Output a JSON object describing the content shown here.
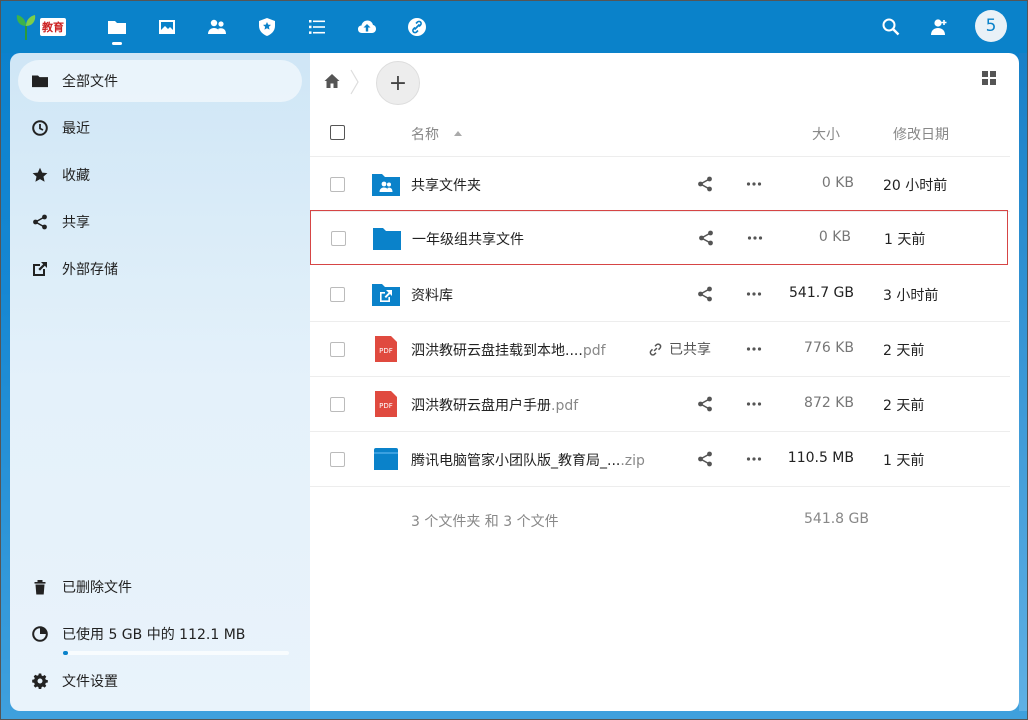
{
  "header": {
    "logo_text": "教育",
    "avatar_letter": "5",
    "apps": [
      {
        "icon": "folder-icon",
        "name": "files"
      },
      {
        "icon": "image-icon",
        "name": "photos"
      },
      {
        "icon": "contacts-icon",
        "name": "contacts"
      },
      {
        "icon": "shield-icon",
        "name": "security"
      },
      {
        "icon": "list-icon",
        "name": "activity"
      },
      {
        "icon": "cloud-upload-icon",
        "name": "upload"
      },
      {
        "icon": "link-icon",
        "name": "external"
      }
    ]
  },
  "sidebar": {
    "items": [
      {
        "label": "全部文件",
        "icon": "folder-icon"
      },
      {
        "label": "最近",
        "icon": "clock-icon"
      },
      {
        "label": "收藏",
        "icon": "star-icon"
      },
      {
        "label": "共享",
        "icon": "share-icon"
      },
      {
        "label": "外部存储",
        "icon": "external-link-icon"
      }
    ],
    "deleted_label": "已删除文件",
    "quota_label": "已使用 5 GB 中的 112.1 MB",
    "quota_fraction": 0.022,
    "settings_label": "文件设置"
  },
  "main": {
    "add_label": "+",
    "columns": {
      "name": "名称",
      "size": "大小",
      "date": "修改日期"
    },
    "files": [
      {
        "name": "共享文件夹",
        "ext": "",
        "type": "shared-folder",
        "size": "0 KB",
        "date": "20 小时前",
        "shared": false
      },
      {
        "name": "一年级组共享文件",
        "ext": "",
        "type": "folder",
        "size": "0 KB",
        "date": "1 天前",
        "shared": false,
        "selected": true
      },
      {
        "name": "资料库",
        "ext": "",
        "type": "external-folder",
        "size": "541.7 GB",
        "date": "3 小时前",
        "shared": false
      },
      {
        "name": "泗洪教研云盘挂载到本地....",
        "ext": "pdf",
        "type": "pdf",
        "size": "776 KB",
        "date": "2 天前",
        "shared": true,
        "shared_label": "已共享"
      },
      {
        "name": "泗洪教研云盘用户手册",
        "ext": ".pdf",
        "type": "pdf",
        "size": "872 KB",
        "date": "2 天前",
        "shared": false
      },
      {
        "name": "腾讯电脑管家小团队版_教育局_...",
        "ext": ".zip",
        "type": "zip",
        "size": "110.5 MB",
        "date": "1 天前",
        "shared": false
      }
    ],
    "summary": "3 个文件夹 和 3 个文件",
    "summary_size": "541.8 GB"
  },
  "colors": {
    "accent": "#0a82ca",
    "selected_border": "#d64545",
    "pdf_red": "#e04a3f"
  }
}
